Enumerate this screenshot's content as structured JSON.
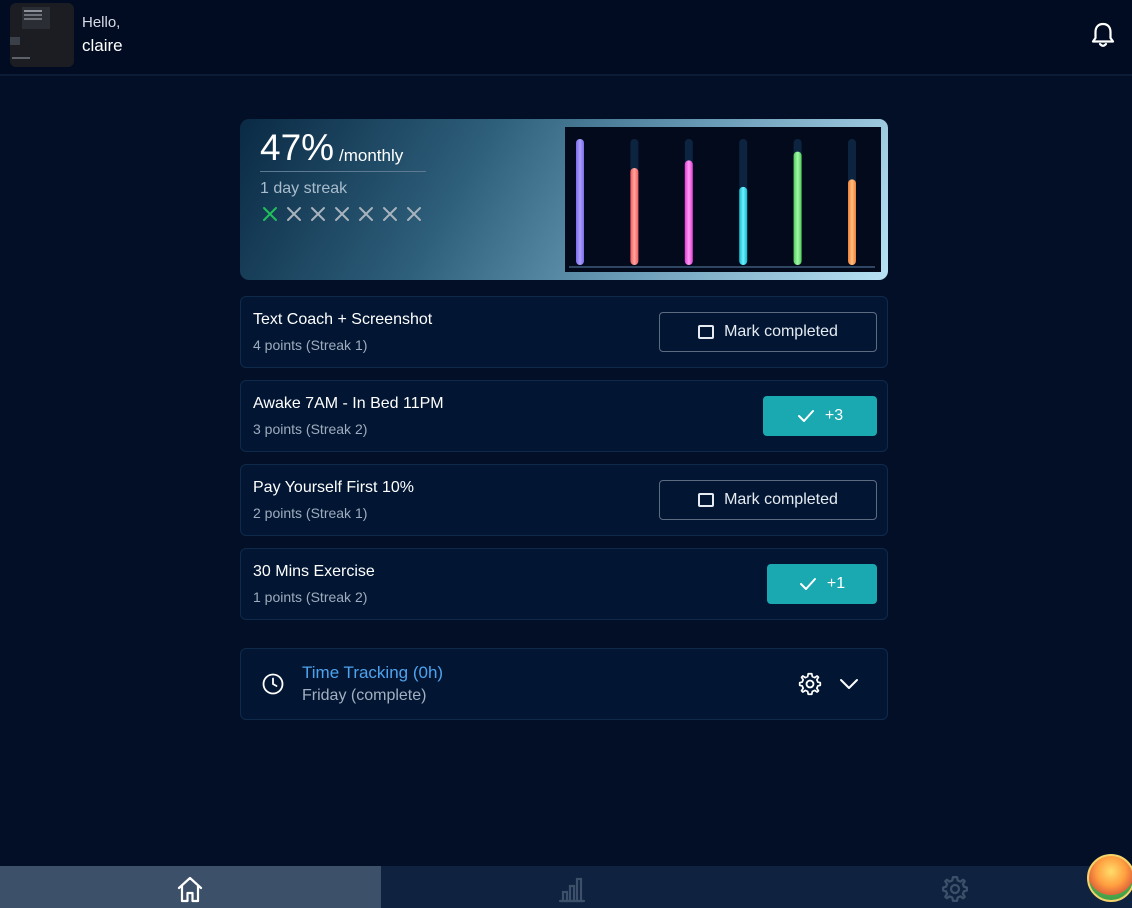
{
  "header": {
    "greeting": "Hello,",
    "username": "claire",
    "avatar_icon": "profile-thumbnail",
    "notification_icon": "bell-icon"
  },
  "summary": {
    "percent": "47%",
    "period": "/monthly",
    "streak_text": "1 day streak",
    "days": [
      "done",
      "missed",
      "missed",
      "missed",
      "missed",
      "missed",
      "missed"
    ],
    "day_colors": {
      "done": "#21c05a",
      "missed": "#a9b3bd"
    }
  },
  "chart_data": {
    "type": "bar",
    "categories": [
      "",
      "",
      "",
      "",
      "",
      ""
    ],
    "values": [
      100,
      77,
      83,
      62,
      90,
      68
    ],
    "ylim": [
      0,
      100
    ],
    "colors": [
      [
        "#7b6cf0",
        "#a99ff7"
      ],
      [
        "#f2585e",
        "#ffa79e"
      ],
      [
        "#e43ad8",
        "#ff9af2"
      ],
      [
        "#13b9cf",
        "#6ff0ff"
      ],
      [
        "#4ecc57",
        "#a2f7a8"
      ],
      [
        "#f17c3a",
        "#ffc07e"
      ]
    ],
    "track_color": "#0d2440",
    "grid": false
  },
  "tasks": [
    {
      "title": "Text Coach + Screenshot",
      "subtitle": "4 points (Streak 1)",
      "state": "pending",
      "button_label": "Mark completed"
    },
    {
      "title": "Awake 7AM - In Bed 11PM",
      "subtitle": "3 points (Streak 2)",
      "state": "completed",
      "button_label": "+3"
    },
    {
      "title": "Pay Yourself First 10%",
      "subtitle": "2 points (Streak 1)",
      "state": "pending",
      "button_label": "Mark completed"
    },
    {
      "title": "30 Mins Exercise",
      "subtitle": "1 points (Streak 2)",
      "state": "completed",
      "button_label": "+1"
    }
  ],
  "time_tracking": {
    "title": "Time Tracking (0h)",
    "subtitle": "Friday (complete)",
    "icons": [
      "clock-icon",
      "gear-icon",
      "chevron-down-icon"
    ]
  },
  "bottom_nav": {
    "items": [
      {
        "icon": "home-icon",
        "active": true
      },
      {
        "icon": "bar-chart-icon",
        "active": false
      },
      {
        "icon": "gear-icon",
        "active": false
      }
    ]
  },
  "colors": {
    "background": "#020f26",
    "accent": "#1aa9b1",
    "link": "#4ea3ee"
  }
}
